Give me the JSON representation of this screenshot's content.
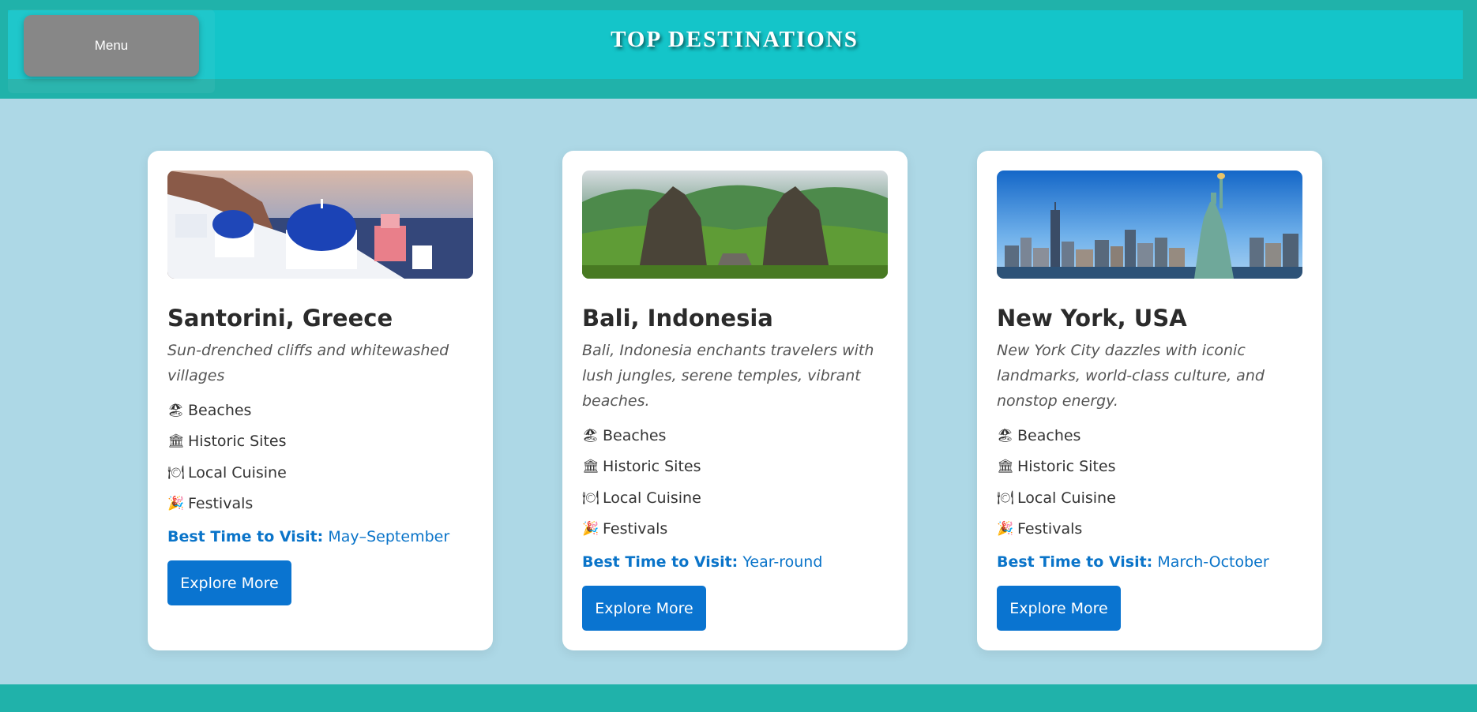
{
  "header": {
    "menu_label": "Menu",
    "title": "TOP DESTINATIONS"
  },
  "colors": {
    "page_background": "#add8e6",
    "header_outer": "#20b2aa",
    "header_inner": "#14c5c9",
    "menu_button": "#878787",
    "accent_blue": "#0a74d0",
    "card_background": "#ffffff"
  },
  "destinations": [
    {
      "title": "Santorini, Greece",
      "description": "Sun-drenched cliffs and whitewashed villages",
      "image_icon": "santorini-photo",
      "features": [
        {
          "icon": "🏖",
          "icon_name": "beach-icon",
          "label": "Beaches"
        },
        {
          "icon": "🏛",
          "icon_name": "historic-site-icon",
          "label": "Historic Sites"
        },
        {
          "icon": "🍽",
          "icon_name": "cuisine-icon",
          "label": "Local Cuisine"
        },
        {
          "icon": "🎉",
          "icon_name": "festival-icon",
          "label": " Festivals"
        }
      ],
      "best_time_label": "Best Time to Visit:",
      "best_time_value": "May–September",
      "button_label": "Explore More"
    },
    {
      "title": "Bali, Indonesia",
      "description": "Bali, Indonesia enchants travelers with lush jungles, serene temples, vibrant beaches.",
      "image_icon": "bali-photo",
      "features": [
        {
          "icon": "🏖",
          "icon_name": "beach-icon",
          "label": "Beaches"
        },
        {
          "icon": "🏛",
          "icon_name": "historic-site-icon",
          "label": "Historic Sites"
        },
        {
          "icon": "🍽",
          "icon_name": "cuisine-icon",
          "label": "Local Cuisine"
        },
        {
          "icon": "🎉",
          "icon_name": "festival-icon",
          "label": " Festivals"
        }
      ],
      "best_time_label": "Best Time to Visit:",
      "best_time_value": "Year-round",
      "button_label": "Explore More"
    },
    {
      "title": "New York, USA",
      "description": "New York City dazzles with iconic landmarks, world-class culture, and nonstop energy.",
      "image_icon": "new-york-photo",
      "features": [
        {
          "icon": "🏖",
          "icon_name": "beach-icon",
          "label": "Beaches"
        },
        {
          "icon": "🏛",
          "icon_name": "historic-site-icon",
          "label": "Historic Sites"
        },
        {
          "icon": "🍽",
          "icon_name": "cuisine-icon",
          "label": "Local Cuisine"
        },
        {
          "icon": "🎉",
          "icon_name": "festival-icon",
          "label": " Festivals"
        }
      ],
      "best_time_label": "Best Time to Visit:",
      "best_time_value": "March-October",
      "button_label": "Explore More"
    }
  ]
}
